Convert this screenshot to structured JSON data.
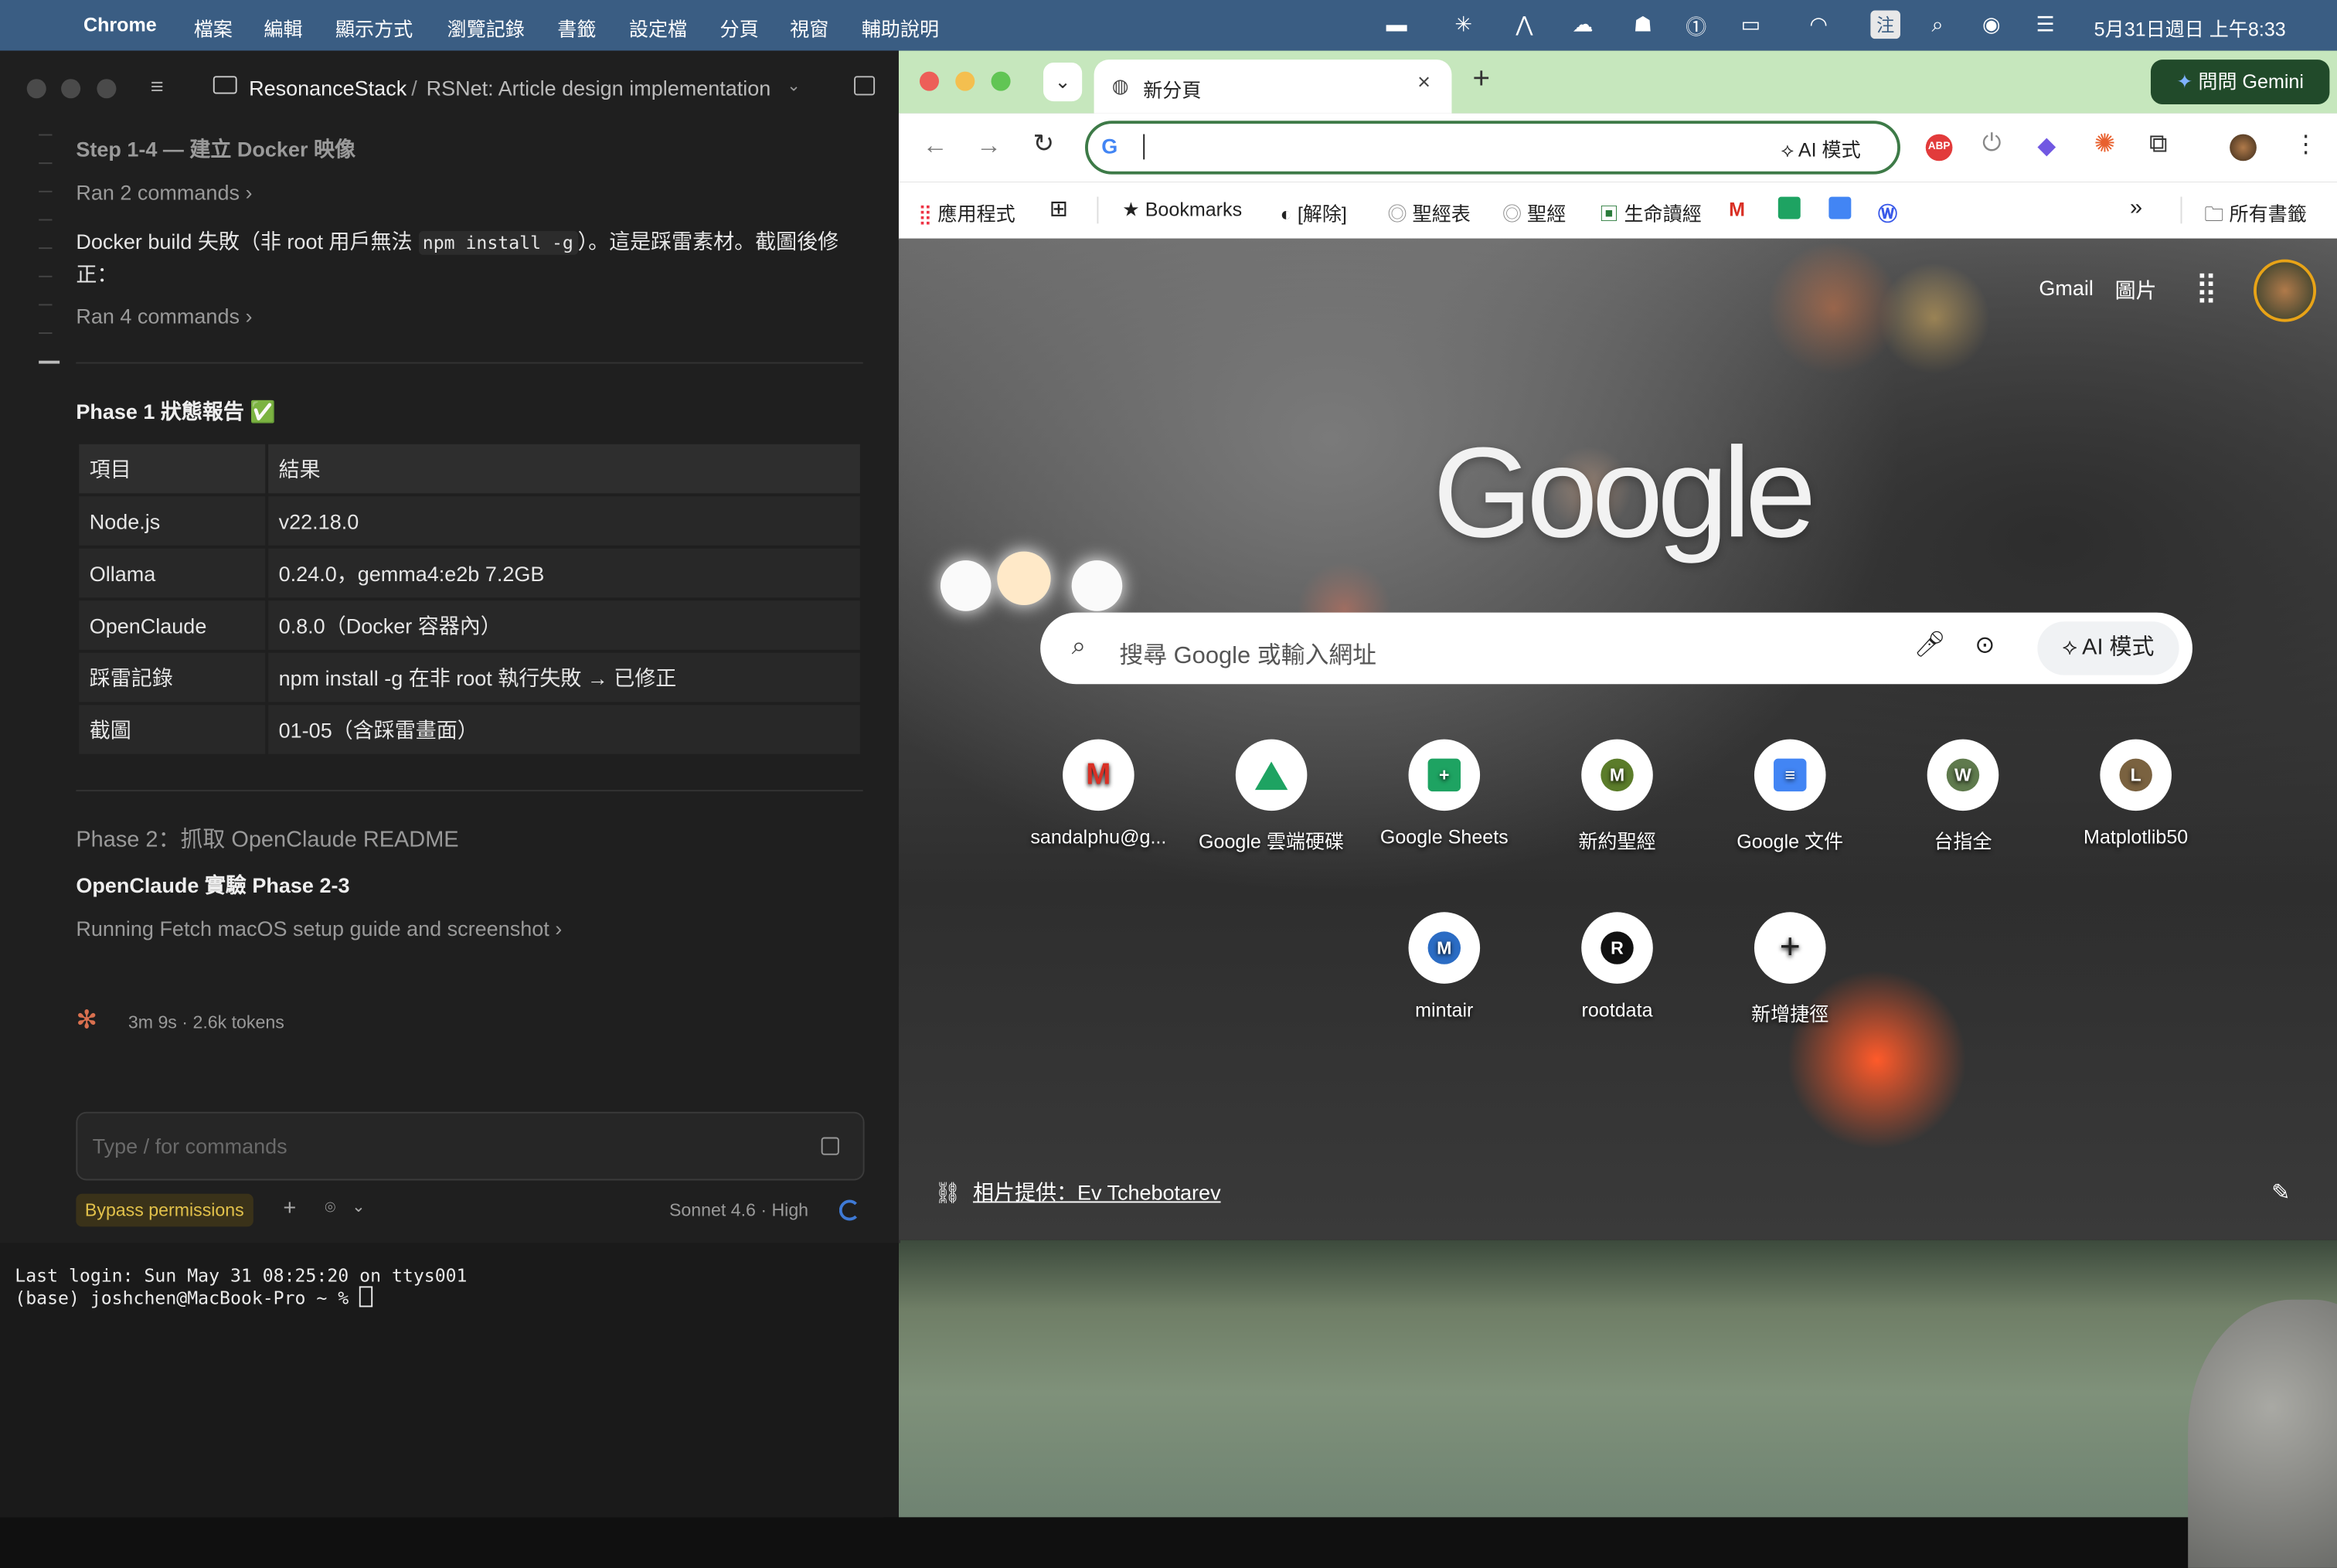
{
  "menubar": {
    "app": "Chrome",
    "items": [
      "檔案",
      "編輯",
      "顯示方式",
      "瀏覽記錄",
      "書籤",
      "設定檔",
      "分頁",
      "視窗",
      "輔助說明"
    ],
    "input_method": "注",
    "clock": "5月31日週日 上午8:33"
  },
  "claude": {
    "workspace": "ResonanceStack",
    "separator": "/",
    "session": "RSNet: Article design implementation",
    "step_title": "Step 1-4 — 建立 Docker 映像",
    "ran2": "Ran 2 commands",
    "docker_msg_a": "Docker build 失敗（非 root 用戶無法 ",
    "docker_msg_code": "npm install -g",
    "docker_msg_b": "）。這是踩雷素材。截圖後修正：",
    "ran4": "Ran 4 commands",
    "phase1_title": "Phase 1 狀態報告 ✅",
    "table": {
      "headers": [
        "項目",
        "結果"
      ],
      "rows": [
        [
          "Node.js",
          "v22.18.0"
        ],
        [
          "Ollama",
          "0.24.0，gemma4:e2b 7.2GB"
        ],
        [
          "OpenClaude",
          "0.8.0（Docker 容器內）"
        ],
        [
          "踩雷記錄",
          "npm install -g 在非 root 執行失敗 → 已修正"
        ],
        [
          "截圖",
          "01-05（含踩雷畫面）"
        ]
      ]
    },
    "phase2": "Phase 2：抓取 OpenClaude README",
    "phase23": "OpenClaude 實驗 Phase 2-3",
    "running": "Running Fetch macOS setup guide and screenshot",
    "elapsed": "3m 9s · 2.6k tokens",
    "input_placeholder": "Type / for commands",
    "bypass": "Bypass permissions",
    "model": "Sonnet 4.6 · High"
  },
  "terminal": {
    "line1": "Last login: Sun May 31 08:25:20 on ttys001",
    "line2": "(base) joshchen@MacBook-Pro ~ % "
  },
  "chrome": {
    "tab_title": "新分頁",
    "gemini": "問問 Gemini",
    "ai_mode": "AI 模式",
    "bookmarks": [
      {
        "label": "應用程式"
      },
      {
        "label": "Bookmarks"
      },
      {
        "label": "[解除]"
      },
      {
        "label": "聖經表"
      },
      {
        "label": "聖經"
      },
      {
        "label": "生命讀經"
      }
    ],
    "all_bookmarks": "所有書籤",
    "ntp": {
      "gmail": "Gmail",
      "images": "圖片",
      "logo": "Google",
      "search_placeholder": "搜尋 Google 或輸入網址",
      "ai_mode": "AI 模式",
      "shortcuts": [
        {
          "label": "sandalphu@g...",
          "letter": "M"
        },
        {
          "label": "Google 雲端硬碟",
          "letter": ""
        },
        {
          "label": "Google Sheets",
          "letter": ""
        },
        {
          "label": "新約聖經",
          "letter": "M"
        },
        {
          "label": "Google 文件",
          "letter": ""
        },
        {
          "label": "台指全",
          "letter": "W"
        },
        {
          "label": "Matplotlib50",
          "letter": "L"
        },
        {
          "label": "mintair",
          "letter": "M"
        },
        {
          "label": "rootdata",
          "letter": "R"
        },
        {
          "label": "新增捷徑",
          "letter": "+"
        }
      ],
      "credit": "相片提供：Ev Tchebotarev"
    }
  }
}
